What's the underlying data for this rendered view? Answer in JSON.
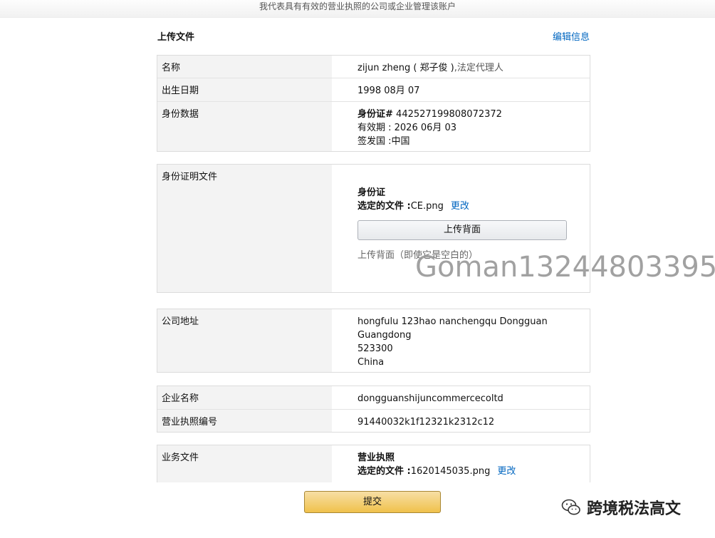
{
  "topbar": {
    "text": "我代表具有有效的营业执照的公司或企业管理该账户"
  },
  "section": {
    "title": "上传文件",
    "edit_label": "编辑信息"
  },
  "identity": {
    "name_label": "名称",
    "name_value": "zijun zheng ( 郑子俊 )",
    "name_role": ",法定代理人",
    "dob_label": "出生日期",
    "dob_value": "1998 08月 07",
    "id_label": "身份数据",
    "id_number_prefix": "身份证#",
    "id_number": "442527199808072372",
    "id_expiry": "有效期 : 2026 06月 03",
    "id_country": "签发国 :中国"
  },
  "id_proof": {
    "label": "身份证明文件",
    "doc_type": "身份证",
    "selected_prefix": "选定的文件 :",
    "selected_file": "CE.png",
    "change_label": "更改",
    "upload_back_label": "上传背面",
    "hint": "上传背面（即使它是空白的）"
  },
  "address": {
    "label": "公司地址",
    "line1": "hongfulu 123hao nanchengqu Dongguan",
    "line2": "Guangdong",
    "line3": "523300",
    "line4": "China"
  },
  "company": {
    "name_label": "企业名称",
    "name_value": "dongguanshijuncommercecoltd",
    "license_label": "营业执照编号",
    "license_value": "91440032k1f12321k2312c12"
  },
  "business_docs": {
    "label": "业务文件",
    "doc_type": "营业执照",
    "selected_prefix": "选定的文件 :",
    "selected_file": "1620145035.png",
    "change_label": "更改"
  },
  "submit_label": "提交",
  "watermark": "Goman13244803395",
  "brand": {
    "text": "跨境税法高文",
    "icon": "wechat-icon"
  }
}
